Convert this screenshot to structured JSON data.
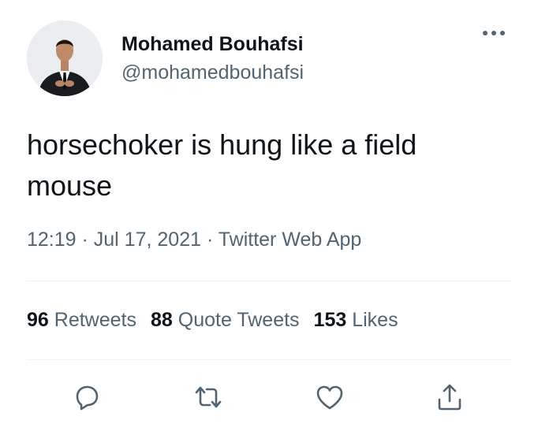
{
  "author": {
    "name": "Mohamed Bouhafsi",
    "handle": "@mohamedbouhafsi"
  },
  "tweet": {
    "text": "horsechoker is hung like a field mouse",
    "meta": "12:19 · Jul 17, 2021 · Twitter Web App"
  },
  "stats": [
    {
      "count": "96",
      "label": "Retweets"
    },
    {
      "count": "88",
      "label": "Quote Tweets"
    },
    {
      "count": "153",
      "label": "Likes"
    }
  ],
  "icons": {
    "more": "more-options-icon",
    "reply": "reply-icon",
    "retweet": "retweet-icon",
    "like": "heart-icon",
    "share": "share-icon"
  },
  "colors": {
    "primary_text": "#0f1419",
    "secondary_text": "#536471",
    "divider": "#eff3f4"
  }
}
